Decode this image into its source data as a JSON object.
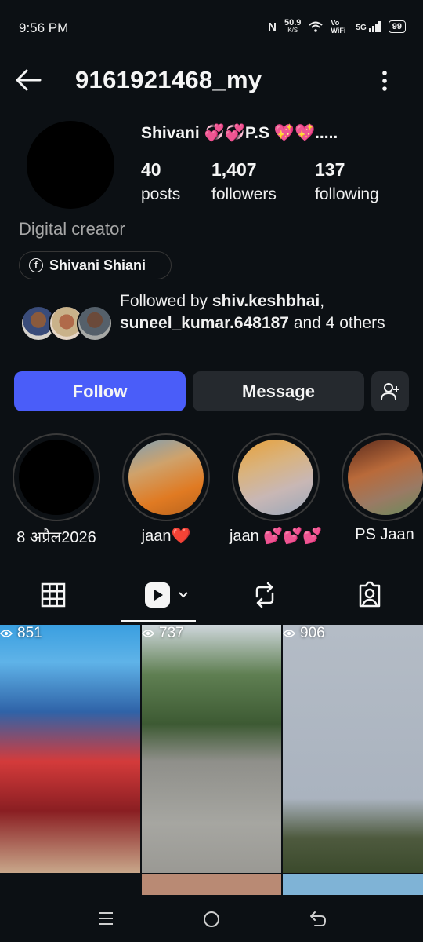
{
  "status": {
    "time": "9:56 PM",
    "speed": "50.9",
    "speed_unit": "K/S",
    "vowifi": "Vo WiFi",
    "net": "5G",
    "battery": "99"
  },
  "header": {
    "username": "9161921468_my"
  },
  "profile": {
    "display_name": "Shivani 💞💞P.S 💖💖.....",
    "posts": {
      "count": "40",
      "label": "posts"
    },
    "followers": {
      "count": "1,407",
      "label": "followers"
    },
    "following": {
      "count": "137",
      "label": "following"
    },
    "category": "Digital creator",
    "facebook_link": "Shivani Shiani",
    "followed_by": {
      "prefix": "Followed by ",
      "user1": "shiv.keshbhai",
      "sep": ", ",
      "user2": "suneel_kumar.648187",
      "suffix": " and 4 others"
    }
  },
  "actions": {
    "follow": "Follow",
    "message": "Message"
  },
  "highlights": [
    {
      "label": "8 अप्रैल2026"
    },
    {
      "label": "jaan❤️"
    },
    {
      "label": "jaan 💕💕💕"
    },
    {
      "label": "PS Jaan"
    }
  ],
  "tabs": [
    "grid",
    "reels",
    "reposts",
    "tagged"
  ],
  "reels": [
    {
      "views": "851"
    },
    {
      "views": "737"
    },
    {
      "views": "906"
    }
  ],
  "icons": {
    "back": "back-arrow-icon",
    "more": "more-vert-icon",
    "add_user": "add-user-icon"
  }
}
